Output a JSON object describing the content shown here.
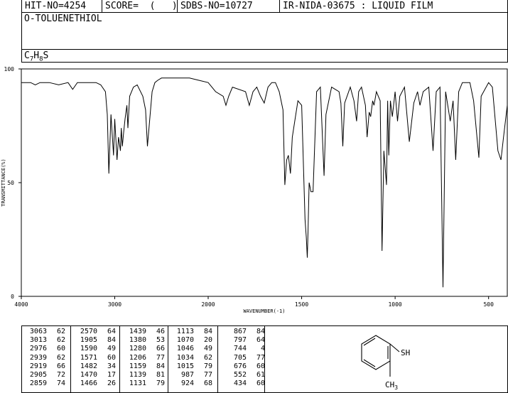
{
  "header": {
    "hit_no": "HIT-NO=4254",
    "score": "SCORE=  (   )",
    "sdbs_no": "SDBS-NO=10727",
    "ir_info": "IR-NIDA-03675 : LIQUID FILM"
  },
  "compound_name": "O-TOLUENETHIOL",
  "formula": {
    "c": "C",
    "c_n": "7",
    "h": "H",
    "h_n": "8",
    "s": "S"
  },
  "chart_data": {
    "type": "line",
    "xlabel": "WAVENUMBER(-1)",
    "ylabel": "TRANSMITTANCE(%)",
    "xlim": [
      4000,
      400
    ],
    "ylim": [
      0,
      100
    ],
    "x_ticks": [
      4000,
      3000,
      2000,
      1500,
      1000,
      500
    ],
    "y_ticks": [
      0,
      50,
      100
    ],
    "series": [
      {
        "x": [
          4000,
          3900,
          3850,
          3800,
          3700,
          3600,
          3500,
          3450,
          3400,
          3300,
          3200,
          3150,
          3100,
          3080,
          3063,
          3040,
          3013,
          3000,
          2976,
          2960,
          2939,
          2930,
          2919,
          2905,
          2890,
          2870,
          2859,
          2840,
          2800,
          2760,
          2700,
          2670,
          2650,
          2600,
          2570,
          2540,
          2500,
          2400,
          2300,
          2200,
          2100,
          2000,
          1960,
          1920,
          1905,
          1890,
          1870,
          1800,
          1780,
          1760,
          1740,
          1720,
          1700,
          1680,
          1660,
          1640,
          1620,
          1600,
          1590,
          1580,
          1571,
          1560,
          1550,
          1520,
          1500,
          1482,
          1475,
          1470,
          1466,
          1460,
          1450,
          1439,
          1420,
          1400,
          1380,
          1370,
          1340,
          1300,
          1290,
          1280,
          1270,
          1240,
          1220,
          1206,
          1195,
          1180,
          1159,
          1150,
          1139,
          1131,
          1120,
          1113,
          1100,
          1080,
          1070,
          1060,
          1046,
          1040,
          1034,
          1025,
          1015,
          1000,
          987,
          975,
          950,
          924,
          900,
          880,
          867,
          850,
          820,
          797,
          780,
          760,
          744,
          730,
          705,
          690,
          676,
          660,
          640,
          600,
          580,
          552,
          540,
          500,
          480,
          450,
          434,
          420,
          400
        ],
        "y": [
          94,
          94,
          93,
          94,
          94,
          93,
          94,
          91,
          94,
          94,
          94,
          93,
          90,
          80,
          54,
          80,
          62,
          78,
          60,
          70,
          64,
          74,
          66,
          72,
          78,
          84,
          74,
          88,
          92,
          93,
          88,
          82,
          66,
          90,
          94,
          95,
          96,
          96,
          96,
          96,
          95,
          94,
          90,
          88,
          84,
          88,
          92,
          90,
          84,
          90,
          92,
          88,
          85,
          92,
          94,
          94,
          90,
          82,
          49,
          60,
          62,
          54,
          70,
          86,
          84,
          34,
          26,
          17,
          28,
          50,
          46,
          46,
          90,
          92,
          53,
          80,
          92,
          90,
          85,
          66,
          85,
          92,
          86,
          77,
          90,
          92,
          84,
          70,
          81,
          79,
          86,
          84,
          90,
          86,
          20,
          64,
          49,
          86,
          62,
          86,
          79,
          90,
          77,
          88,
          92,
          68,
          85,
          90,
          84,
          90,
          92,
          64,
          90,
          92,
          4,
          90,
          77,
          86,
          60,
          90,
          94,
          94,
          86,
          61,
          88,
          94,
          92,
          64,
          60,
          70,
          84
        ]
      }
    ]
  },
  "peaks": [
    {
      "w": "3063",
      "t": "62"
    },
    {
      "w": "3013",
      "t": "62"
    },
    {
      "w": "2976",
      "t": "60"
    },
    {
      "w": "2939",
      "t": "62"
    },
    {
      "w": "2919",
      "t": "66"
    },
    {
      "w": "2905",
      "t": "72"
    },
    {
      "w": "2859",
      "t": "74"
    },
    {
      "w": "2570",
      "t": "64"
    },
    {
      "w": "1905",
      "t": "84"
    },
    {
      "w": "1590",
      "t": "49"
    },
    {
      "w": "1571",
      "t": "60"
    },
    {
      "w": "1482",
      "t": "34"
    },
    {
      "w": "1470",
      "t": "17"
    },
    {
      "w": "1466",
      "t": "26"
    },
    {
      "w": "1439",
      "t": "46"
    },
    {
      "w": "1380",
      "t": "53"
    },
    {
      "w": "1280",
      "t": "66"
    },
    {
      "w": "1206",
      "t": "77"
    },
    {
      "w": "1159",
      "t": "84"
    },
    {
      "w": "1139",
      "t": "81"
    },
    {
      "w": "1131",
      "t": "79"
    },
    {
      "w": "1113",
      "t": "84"
    },
    {
      "w": "1070",
      "t": "20"
    },
    {
      "w": "1046",
      "t": "49"
    },
    {
      "w": "1034",
      "t": "62"
    },
    {
      "w": "1015",
      "t": "79"
    },
    {
      "w": "987",
      "t": "77"
    },
    {
      "w": "924",
      "t": "68"
    },
    {
      "w": "867",
      "t": "84"
    },
    {
      "w": "797",
      "t": "64"
    },
    {
      "w": "744",
      "t": "4"
    },
    {
      "w": "705",
      "t": "77"
    },
    {
      "w": "676",
      "t": "60"
    },
    {
      "w": "552",
      "t": "61"
    },
    {
      "w": "434",
      "t": "60"
    }
  ],
  "structure": {
    "sh": "SH",
    "ch3": "CH",
    "ch3_sub": "3"
  }
}
